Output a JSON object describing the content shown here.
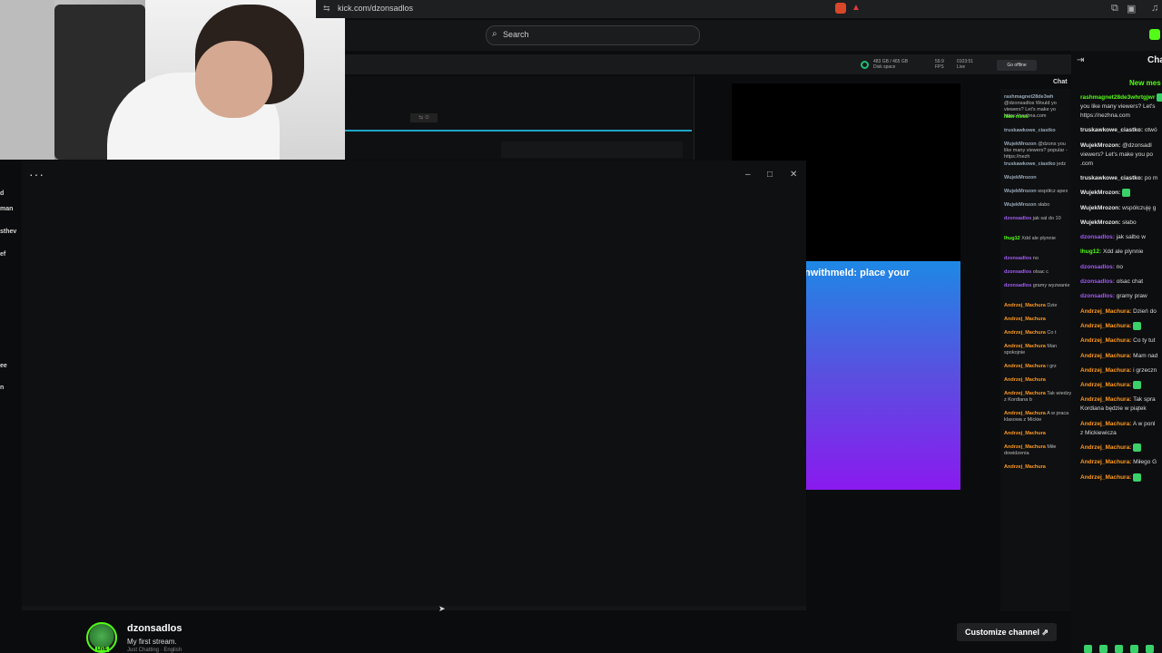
{
  "browser": {
    "url": "kick.com/dzonsadlos"
  },
  "site": {
    "search_placeholder": "Search"
  },
  "studio": {
    "disk_stats": "483 GB / 465 GB",
    "disk_label": "Disk space",
    "fps_value": "59.9",
    "fps_label": "FPS",
    "live_time": "0103:51",
    "live_label": "Live",
    "go_offline": "Go offline",
    "chat_label": "Chat",
    "overlay_text": "nwithmeld: place your"
  },
  "sidebar_fragments": [
    "d",
    "man",
    "sthev",
    "ef",
    "ee",
    "n"
  ],
  "mid_chat": [
    {
      "u": "rashmagnet28de3wh",
      "m": "@dzonsadlos Would yo viewers? Let's make yo https://nezhna.com"
    },
    {
      "u": "New mess",
      "m": ""
    },
    {
      "u": "truskawkowe_ciastko",
      "m": ""
    },
    {
      "u": "WujekMrozon",
      "m": "@dzons you like many viewers? popular - https://nezh"
    },
    {
      "u": "truskawkowe_ciastko",
      "m": "jedz"
    },
    {
      "u": "WujekMrozon",
      "m": ""
    },
    {
      "u": "WujekMrozon",
      "m": "współcz apex"
    },
    {
      "u": "WujekMrozon",
      "m": "słabo"
    },
    {
      "u": "dzonsadlos",
      "m": "jak sal do 10"
    },
    {
      "u": "lhug12",
      "m": "Xdd ale plynnie"
    },
    {
      "u": "dzonsadlos",
      "m": "no"
    },
    {
      "u": "dzonsadlos",
      "m": "olsac c"
    },
    {
      "u": "dzonsadlos",
      "m": "gramy wyzwanie"
    },
    {
      "u": "Andrzej_Machura",
      "m": "Dzie"
    },
    {
      "u": "Andrzej_Machura",
      "m": ""
    },
    {
      "u": "Andrzej_Machura",
      "m": "Co t"
    },
    {
      "u": "Andrzej_Machura",
      "m": "Man spokojnie"
    },
    {
      "u": "Andrzej_Machura",
      "m": "i grz"
    },
    {
      "u": "Andrzej_Machura",
      "m": ""
    },
    {
      "u": "Andrzej_Machura",
      "m": "Tak wiedzy z Kordiana b"
    },
    {
      "u": "Andrzej_Machura",
      "m": "A w praca klasowa z Mickie"
    },
    {
      "u": "Andrzej_Machura",
      "m": ""
    },
    {
      "u": "Andrzej_Machura",
      "m": "Miłe dowidzenia"
    },
    {
      "u": "Andrzej_Machura",
      "m": ""
    }
  ],
  "chat": {
    "title": "Cha",
    "new_messages": "New mes",
    "messages": [
      {
        "u": "rashmagnet28de3whrtgjwr",
        "m": "",
        "color": "#53fc18"
      },
      {
        "u": "",
        "m": "you like many viewers? Let's",
        "color": "#ddd"
      },
      {
        "u": "",
        "m": "https://nezhna.com",
        "color": "#ddd"
      },
      {
        "u": "truskawkowe_ciastko:",
        "m": "otwó",
        "color": "#e8e8e8"
      },
      {
        "u": "WujekMrozon:",
        "m": "@dzonsadl",
        "color": "#e8e8e8"
      },
      {
        "u": "",
        "m": "viewers? Let's make you po",
        "color": "#ddd"
      },
      {
        "u": "",
        "m": ".com",
        "color": "#ddd"
      },
      {
        "u": "truskawkowe_ciastko:",
        "m": "po m",
        "color": "#e8e8e8"
      },
      {
        "u": "WujekMrozon:",
        "m": "",
        "color": "#e8e8e8"
      },
      {
        "u": "WujekMrozon:",
        "m": "współczuję g",
        "color": "#e8e8e8"
      },
      {
        "u": "WujekMrozon:",
        "m": "słabo",
        "color": "#e8e8e8"
      },
      {
        "u": "dzonsadlos:",
        "m": "jak salbo w",
        "color": "#a25cf5"
      },
      {
        "u": "lhug12:",
        "m": "Xdd ale plynnie",
        "color": "#53fc18"
      },
      {
        "u": "dzonsadlos:",
        "m": "no",
        "color": "#a25cf5"
      },
      {
        "u": "dzonsadlos:",
        "m": "olsac chat",
        "color": "#a25cf5"
      },
      {
        "u": "dzonsadlos:",
        "m": "gramy praw",
        "color": "#a25cf5"
      },
      {
        "u": "Andrzej_Machura:",
        "m": "Dzień do",
        "color": "#ff9a1f"
      },
      {
        "u": "Andrzej_Machura:",
        "m": "",
        "color": "#ff9a1f"
      },
      {
        "u": "Andrzej_Machura:",
        "m": "Co ty tut",
        "color": "#ff9a1f"
      },
      {
        "u": "Andrzej_Machura:",
        "m": "Mam nad",
        "color": "#ff9a1f"
      },
      {
        "u": "Andrzej_Machura:",
        "m": "i grzeczn",
        "color": "#ff9a1f"
      },
      {
        "u": "Andrzej_Machura:",
        "m": "",
        "color": "#ff9a1f"
      },
      {
        "u": "Andrzej_Machura:",
        "m": "Tak spra",
        "color": "#ff9a1f"
      },
      {
        "u": "",
        "m": "Kordiana będzie w piątek",
        "color": "#ddd"
      },
      {
        "u": "Andrzej_Machura:",
        "m": "A w ponl",
        "color": "#ff9a1f"
      },
      {
        "u": "",
        "m": "z Mickiewicza",
        "color": "#ddd"
      },
      {
        "u": "Andrzej_Machura:",
        "m": "",
        "color": "#ff9a1f"
      },
      {
        "u": "Andrzej_Machura:",
        "m": "Miłego G",
        "color": "#ff9a1f"
      },
      {
        "u": "Andrzej_Machura:",
        "m": "",
        "color": "#ff9a1f"
      }
    ]
  },
  "channel": {
    "name": "dzonsadlos",
    "title": "My first stream.",
    "category": "Just Chatting",
    "language": "English",
    "live_badge": "LIVE",
    "customize_label": "Customize channel"
  },
  "colors": {
    "kick_green": "#53fc18",
    "accent_blue": "#1fa4c9"
  }
}
